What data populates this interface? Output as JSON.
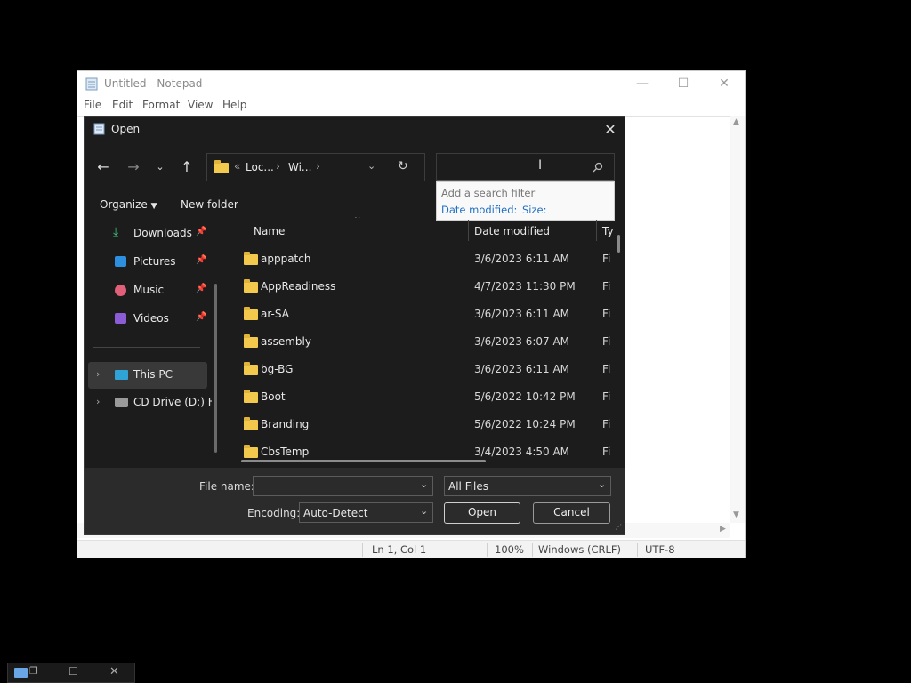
{
  "notepad": {
    "title": "Untitled - Notepad",
    "menu": [
      "File",
      "Edit",
      "Format",
      "View",
      "Help"
    ],
    "status": {
      "position": "Ln 1, Col 1",
      "zoom": "100%",
      "line_ending": "Windows (CRLF)",
      "encoding": "UTF-8"
    }
  },
  "dialog": {
    "title": "Open",
    "address": {
      "seg1": "Loc...",
      "seg2": "Wi...",
      "prefix": "«"
    },
    "search_popup": {
      "hint": "Add a search filter",
      "filter1": "Date modified:",
      "filter2": "Size:"
    },
    "toolbar": {
      "organize": "Organize",
      "new_folder": "New folder"
    },
    "nav": {
      "quick": [
        {
          "label": "Downloads",
          "icon": "download-icon"
        },
        {
          "label": "Pictures",
          "icon": "pictures-icon"
        },
        {
          "label": "Music",
          "icon": "music-icon"
        },
        {
          "label": "Videos",
          "icon": "videos-icon"
        }
      ],
      "this_pc": "This PC",
      "cd_drive": "CD Drive (D:) HE"
    },
    "columns": {
      "name": "Name",
      "date": "Date modified",
      "type": "Ty"
    },
    "files": [
      {
        "name": "apppatch",
        "date": "3/6/2023 6:11 AM",
        "type": "Fi"
      },
      {
        "name": "AppReadiness",
        "date": "4/7/2023 11:30 PM",
        "type": "Fi"
      },
      {
        "name": "ar-SA",
        "date": "3/6/2023 6:11 AM",
        "type": "Fi"
      },
      {
        "name": "assembly",
        "date": "3/6/2023 6:07 AM",
        "type": "Fi"
      },
      {
        "name": "bg-BG",
        "date": "3/6/2023 6:11 AM",
        "type": "Fi"
      },
      {
        "name": "Boot",
        "date": "5/6/2022 10:42 PM",
        "type": "Fi"
      },
      {
        "name": "Branding",
        "date": "5/6/2022 10:24 PM",
        "type": "Fi"
      },
      {
        "name": "CbsTemp",
        "date": "3/4/2023 4:50 AM",
        "type": "Fi"
      }
    ],
    "bottom": {
      "file_name_label": "File name:",
      "file_name_value": "",
      "filter": "All Files",
      "encoding_label": "Encoding:",
      "encoding_value": "Auto-Detect",
      "open": "Open",
      "cancel": "Cancel"
    }
  },
  "colors": {
    "accent": "#4aa3ff",
    "folder": "#f2c94c",
    "dialog_bg": "#1c1c1c"
  }
}
